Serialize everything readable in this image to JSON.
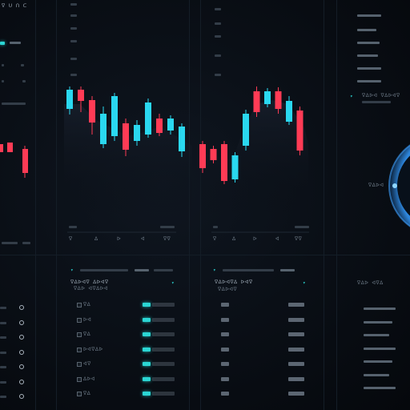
{
  "theme": {
    "background": "#080d13",
    "accent_up": "#2ad8f0",
    "accent_down": "#ff3b55",
    "grid": "#141d27"
  },
  "header": {
    "top_left_label": "ᐁ ᑌ ᑎ ᑕ"
  },
  "charts": {
    "left_chart": {
      "type": "candlestick",
      "candles": [
        {
          "o": 112,
          "c": 136,
          "h": 108,
          "l": 143,
          "dir": "up"
        },
        {
          "o": 112,
          "c": 126,
          "h": 108,
          "l": 140,
          "dir": "down"
        },
        {
          "o": 125,
          "c": 153,
          "h": 120,
          "l": 168,
          "dir": "down"
        },
        {
          "o": 142,
          "c": 180,
          "h": 133,
          "l": 185,
          "dir": "up"
        },
        {
          "o": 120,
          "c": 170,
          "h": 116,
          "l": 176,
          "dir": "up"
        },
        {
          "o": 154,
          "c": 187,
          "h": 148,
          "l": 195,
          "dir": "down"
        },
        {
          "o": 156,
          "c": 176,
          "h": 150,
          "l": 182,
          "dir": "up"
        },
        {
          "o": 128,
          "c": 168,
          "h": 123,
          "l": 172,
          "dir": "up"
        },
        {
          "o": 148,
          "c": 166,
          "h": 142,
          "l": 170,
          "dir": "down"
        },
        {
          "o": 148,
          "c": 163,
          "h": 144,
          "l": 168,
          "dir": "up"
        },
        {
          "o": 158,
          "c": 189,
          "h": 154,
          "l": 196,
          "dir": "up"
        }
      ],
      "bottom_labels": [
        "ᐁ",
        "ᐃ",
        "ᐅ",
        "ᐊ",
        "ᐁᐁ"
      ]
    },
    "mid_chart": {
      "type": "candlestick",
      "candles": [
        {
          "o": 180,
          "c": 210,
          "h": 176,
          "l": 216,
          "dir": "down"
        },
        {
          "o": 186,
          "c": 200,
          "h": 182,
          "l": 204,
          "dir": "down"
        },
        {
          "o": 180,
          "c": 226,
          "h": 176,
          "l": 230,
          "dir": "down"
        },
        {
          "o": 194,
          "c": 224,
          "h": 190,
          "l": 228,
          "dir": "up"
        },
        {
          "o": 142,
          "c": 182,
          "h": 137,
          "l": 188,
          "dir": "up"
        },
        {
          "o": 114,
          "c": 140,
          "h": 108,
          "l": 146,
          "dir": "down"
        },
        {
          "o": 114,
          "c": 130,
          "h": 110,
          "l": 134,
          "dir": "up"
        },
        {
          "o": 114,
          "c": 136,
          "h": 109,
          "l": 142,
          "dir": "down"
        },
        {
          "o": 126,
          "c": 152,
          "h": 120,
          "l": 156,
          "dir": "up"
        },
        {
          "o": 138,
          "c": 188,
          "h": 133,
          "l": 194,
          "dir": "down"
        }
      ],
      "bottom_labels": [
        "ᐁ",
        "ᐃ",
        "ᐅ",
        "ᐊ",
        "ᐁᐁ"
      ]
    }
  },
  "panels": {
    "left_list": {
      "title": "ᐁᐃᐅᐊᐁ ᐃᐅᐊᐁ",
      "subtitle": "ᐁᐃᐅ ᐊᐁᐃᐅᐊ",
      "rows": [
        "ᐁᐃ",
        "ᐅᐊ",
        "ᐁᐃ",
        "ᐅᐊᐁᐃᐅ",
        "ᐊᐁ",
        "ᐃᐅᐊ",
        "ᐁᐃ"
      ]
    },
    "mid_list": {
      "title": "ᐁᐃᐅᐊᐁᐃ ᐅᐊᐁ",
      "subtitle": "ᐁᐃᐅᐊᐁ",
      "rows": [
        "ᐁ",
        "ᐃ",
        "ᐅ",
        "ᐊ",
        "ᐁ",
        "ᐃ",
        "ᐅ"
      ]
    },
    "right_panel": {
      "title": "ᐁᐃᐅᐊ ᐁᐃᐅᐊᐁ",
      "gauge_label": "ᐁᐃᐅᐊ",
      "list_title": "ᐁᐃᐅ ᐊᐁᐃ"
    }
  }
}
